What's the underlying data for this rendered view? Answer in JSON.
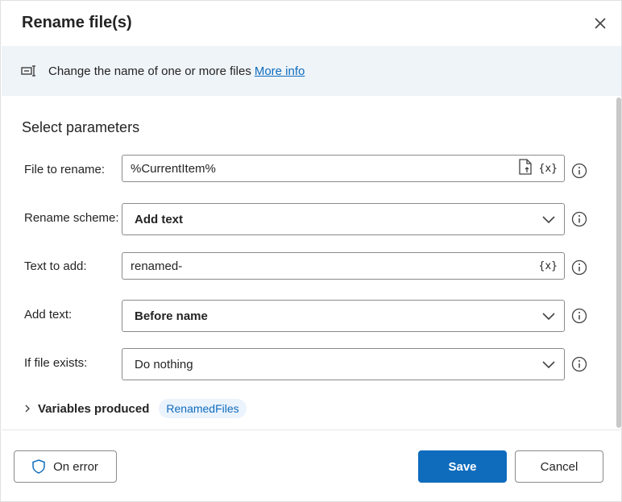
{
  "dialog": {
    "title": "Rename file(s)",
    "close_icon": "close-icon"
  },
  "banner": {
    "icon": "rename-icon",
    "text": "Change the name of one or more files",
    "link": "More info"
  },
  "section_title": "Select parameters",
  "fields": [
    {
      "label": "File to rename:",
      "value": "%CurrentItem%",
      "type": "text",
      "icons": [
        "file-icon",
        "variable-icon"
      ]
    },
    {
      "label": "Rename scheme:",
      "value": "Add text",
      "type": "select"
    },
    {
      "label": "Text to add:",
      "value": "renamed-",
      "type": "text",
      "icons": [
        "variable-icon"
      ]
    },
    {
      "label": "Add text:",
      "value": "Before name",
      "type": "select"
    },
    {
      "label": "If file exists:",
      "value": "Do nothing",
      "type": "select"
    }
  ],
  "variable_button_label": "{x}",
  "variables": {
    "label": "Variables produced",
    "items": [
      "RenamedFiles"
    ]
  },
  "footer": {
    "on_error": "On error",
    "save": "Save",
    "cancel": "Cancel"
  },
  "colors": {
    "accent": "#0f6cbd",
    "banner_bg": "#eff4f9",
    "pill_bg": "#ebf3fc"
  }
}
